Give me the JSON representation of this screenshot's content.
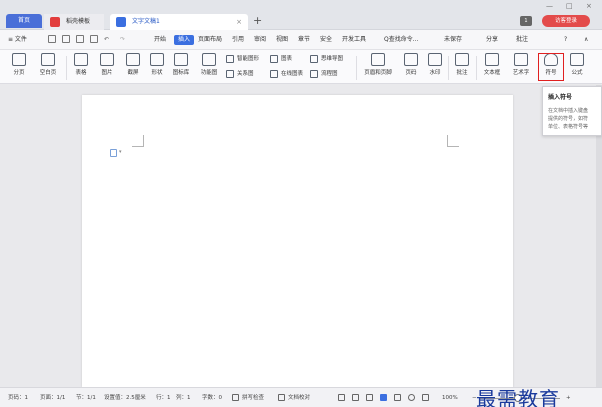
{
  "tabs": {
    "home": "首页",
    "template": "稻壳模板",
    "doc": "文字文稿1",
    "close": "×",
    "add": "+"
  },
  "window": {
    "badge": "1",
    "login": "访客登录",
    "min": "—",
    "max": "□",
    "close": "×"
  },
  "menu": {
    "file": "≡ 文件",
    "items": [
      "开始",
      "插入",
      "页面布局",
      "引用",
      "审阅",
      "视图",
      "章节",
      "安全",
      "开发工具"
    ],
    "active_index": 1,
    "search": "Q查找命令...",
    "unsaved": "未保存",
    "share": "分享",
    "comment": "批注",
    "help": "?",
    "collapse": "∧"
  },
  "ribbon": {
    "large": [
      {
        "name": "page-break",
        "label": "分页"
      },
      {
        "name": "blank-page",
        "label": "空白页"
      },
      {
        "name": "table",
        "label": "表格"
      },
      {
        "name": "picture",
        "label": "图片"
      },
      {
        "name": "screenshot",
        "label": "截屏"
      },
      {
        "name": "shape",
        "label": "形状"
      },
      {
        "name": "icon-lib",
        "label": "图标库"
      },
      {
        "name": "function-chart",
        "label": "功能图"
      },
      {
        "name": "header-footer",
        "label": "页眉和页脚"
      },
      {
        "name": "page-number",
        "label": "页码"
      },
      {
        "name": "watermark",
        "label": "水印"
      },
      {
        "name": "comment",
        "label": "批注"
      },
      {
        "name": "textbox",
        "label": "文本框"
      },
      {
        "name": "wordart",
        "label": "艺术字"
      },
      {
        "name": "symbol",
        "label": "符号"
      },
      {
        "name": "formula",
        "label": "公式"
      }
    ],
    "small": [
      {
        "name": "smart-graphic",
        "label": "智能图形"
      },
      {
        "name": "chart",
        "label": "图表"
      },
      {
        "name": "mind-map",
        "label": "思维导图"
      },
      {
        "name": "relation-map",
        "label": "关系图"
      },
      {
        "name": "online-chart",
        "label": "在线图表"
      },
      {
        "name": "flowchart",
        "label": "流程图"
      }
    ]
  },
  "tooltip": {
    "title": "插入符号",
    "lines": [
      "在文档中插入键盘",
      "提供的符号，如符",
      "单位、表格符号等"
    ]
  },
  "status": {
    "page_num": "页码：1",
    "pages": "页面：1/1",
    "section": "节：1/1",
    "setting": "设置值：2.5厘米",
    "row": "行：1",
    "col": "列：1",
    "words": "字数：0",
    "spell": "拼写检查",
    "proof": "文档校对",
    "zoom": "100%",
    "zoom_minus": "−",
    "zoom_plus": "+"
  },
  "watermark_text": "最需教育"
}
